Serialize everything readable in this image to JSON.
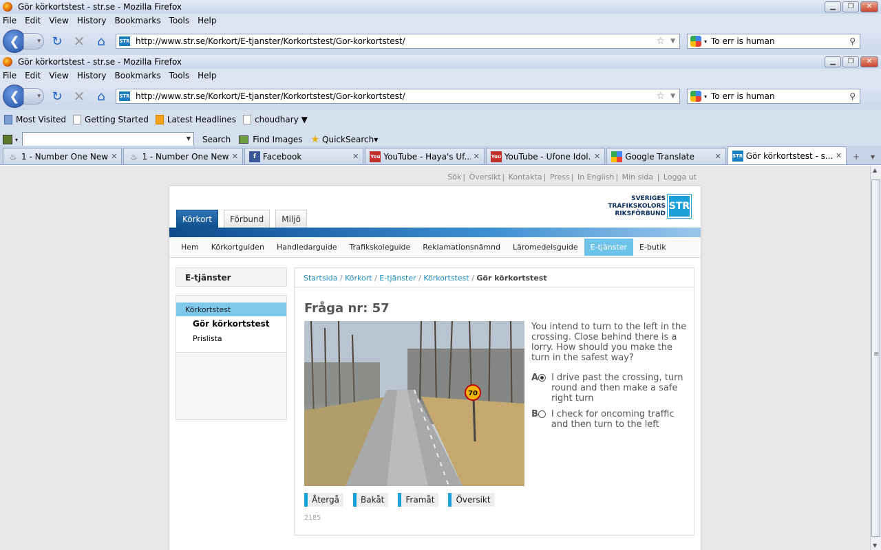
{
  "window": {
    "title": "Gör körkortstest - str.se - Mozilla Firefox",
    "min": "▁",
    "max": "❐",
    "close": "✕"
  },
  "menu": [
    "File",
    "Edit",
    "View",
    "History",
    "Bookmarks",
    "Tools",
    "Help"
  ],
  "url": "http://www.str.se/Korkort/E-tjanster/Korkortstest/Gor-korkortstest/",
  "search_value": "To err is human",
  "bookmarks": [
    "Most Visited",
    "Getting Started",
    "Latest Headlines",
    "choudhary ▼"
  ],
  "toolbar": {
    "search": "Search",
    "find_images": "Find Images",
    "quicksearch": "QuickSearch▾"
  },
  "tabs": [
    {
      "label": "1 - Number One New...",
      "icon": "swirl-icon"
    },
    {
      "label": "1 - Number One New...",
      "icon": "swirl-icon"
    },
    {
      "label": "Facebook",
      "icon": "facebook-icon"
    },
    {
      "label": "YouTube - Haya's Uf...",
      "icon": "youtube-icon"
    },
    {
      "label": "YouTube - Ufone Idol...",
      "icon": "youtube-icon"
    },
    {
      "label": "Google Translate",
      "icon": "google-icon"
    },
    {
      "label": "Gör körkortstest - s...",
      "icon": "str-icon"
    }
  ],
  "site": {
    "toplinks": [
      "Sök",
      "Översikt",
      "Kontakta",
      "Press",
      "In English",
      "Min sida",
      "Logga ut"
    ],
    "logo": {
      "line1": "SVERIGES",
      "line2": "TRAFIKSKOLORS",
      "line3": "RIKSFÖRBUND",
      "mark": "STR"
    },
    "toptabs": [
      "Körkort",
      "Förbund",
      "Miljö"
    ],
    "subnav": [
      "Hem",
      "Körkortguiden",
      "Handledarguide",
      "Trafikskoleguide",
      "Reklamationsnämnd",
      "Läromedelsguide",
      "E-tjänster",
      "E-butik"
    ],
    "left": {
      "heading": "E-tjänster",
      "current": "Körkortstest",
      "links": [
        "Gör körkortstest",
        "Prislista"
      ]
    },
    "breadcrumb": [
      "Startsida",
      "Körkort",
      "E-tjänster",
      "Körkortstest"
    ],
    "breadcrumb_current": "Gör körkortstest",
    "question_title": "Fråga nr: 57",
    "question": "You intend to turn to the left in the crossing. Close behind there is a lorry. How should you make the turn in the safest way?",
    "options": [
      {
        "letter": "A",
        "text": "I drive past the crossing, turn round and then make a safe right turn",
        "selected": true
      },
      {
        "letter": "B",
        "text": "I check for oncoming traffic and then turn to the left",
        "selected": false
      }
    ],
    "buttons": [
      "Återgå",
      "Bakåt",
      "Framåt",
      "Översikt"
    ],
    "code": "2185",
    "sign": "70"
  }
}
